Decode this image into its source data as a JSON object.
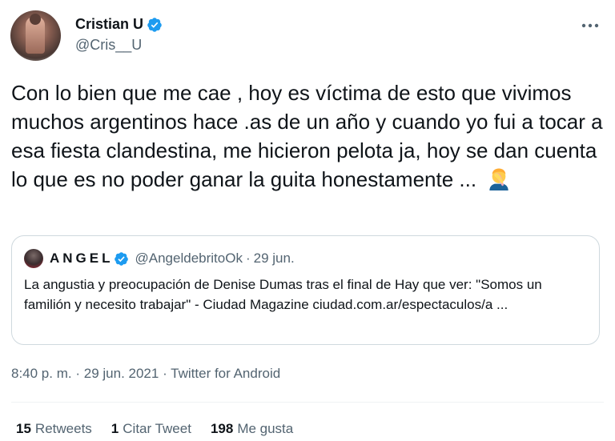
{
  "author": {
    "display_name": "Cristian U",
    "handle": "@Cris__U",
    "verified_icon": "verified-badge-icon",
    "avatar": "profile-avatar"
  },
  "more_icon": "more-dots-icon",
  "tweet": {
    "text": "Con lo bien que me cae , hoy es víctima de esto que vivimos muchos argentinos hace .as de un año y cuando yo fui a tocar a esa fiesta clandestina, me hicieron pelota ja, hoy se dan cuenta lo que es no poder ganar la guita honestamente ...",
    "emoji_icon": "facepalm-emoji-icon"
  },
  "quoted_tweet": {
    "display_name": "ANGEL",
    "handle": "@AngeldebritoOk",
    "separator": "·",
    "date": "29 jun.",
    "text": "La angustia y preocupación de Denise Dumas tras el final de Hay que ver: \"Somos un familión y necesito trabajar\" - Ciudad Magazine ciudad.com.ar/espectaculos/a ..."
  },
  "meta": {
    "time": "8:40 p. m.",
    "sep1": "·",
    "date": "29 jun. 2021",
    "sep2": "·",
    "source": "Twitter for Android"
  },
  "stats": {
    "retweets_count": "15",
    "retweets_label": "Retweets",
    "quotes_count": "1",
    "quotes_label": "Citar Tweet",
    "likes_count": "198",
    "likes_label": "Me gusta"
  },
  "colors": {
    "accent": "#1d9bf0",
    "text_primary": "#0f1419",
    "text_secondary": "#536471",
    "border": "#cfd9de"
  }
}
